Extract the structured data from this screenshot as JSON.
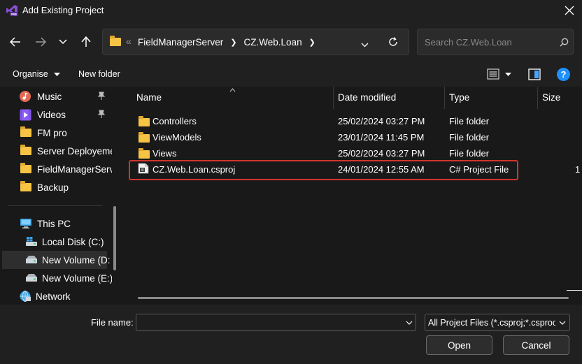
{
  "window": {
    "title": "Add Existing Project"
  },
  "nav": {
    "breadcrumb": [
      "FieldManagerServer",
      "CZ.Web.Loan"
    ],
    "search_placeholder": "Search CZ.Web.Loan"
  },
  "toolbar": {
    "organise_label": "Organise",
    "new_folder_label": "New folder"
  },
  "sidebar": {
    "items": [
      {
        "label": "Music",
        "icon": "music-icon",
        "pinned": true
      },
      {
        "label": "Videos",
        "icon": "videos-icon",
        "pinned": true
      },
      {
        "label": "FM pro",
        "icon": "folder-icon"
      },
      {
        "label": "Server Deployeme",
        "icon": "folder-icon"
      },
      {
        "label": "FieldManagerServ",
        "icon": "folder-icon"
      },
      {
        "label": "Backup",
        "icon": "folder-icon"
      }
    ],
    "this_pc": "This PC",
    "drives": [
      {
        "label": "Local Disk (C:)"
      },
      {
        "label": "New Volume (D:",
        "selected": true
      },
      {
        "label": "New Volume (E:)"
      }
    ],
    "network": "Network"
  },
  "file_list": {
    "columns": {
      "name": "Name",
      "date": "Date modified",
      "type": "Type",
      "size": "Size"
    },
    "rows": [
      {
        "name": "Controllers",
        "date": "25/02/2024 03:27 PM",
        "type": "File folder",
        "size": "",
        "kind": "folder"
      },
      {
        "name": "ViewModels",
        "date": "23/01/2024 11:45 PM",
        "type": "File folder",
        "size": "",
        "kind": "folder"
      },
      {
        "name": "Views",
        "date": "25/02/2024 03:27 PM",
        "type": "File folder",
        "size": "",
        "kind": "folder"
      },
      {
        "name": "CZ.Web.Loan.csproj",
        "date": "24/01/2024 12:55 AM",
        "type": "C# Project File",
        "size": "1",
        "kind": "csproj",
        "highlighted": true
      }
    ]
  },
  "footer": {
    "file_name_label": "File name:",
    "file_name_value": "",
    "filter_value": "All Project Files (*.csproj;*.csproc",
    "open_label": "Open",
    "cancel_label": "Cancel"
  },
  "colors": {
    "highlight": "#d2352c",
    "folder": "#f6c344",
    "accent": "#0a84ff"
  }
}
